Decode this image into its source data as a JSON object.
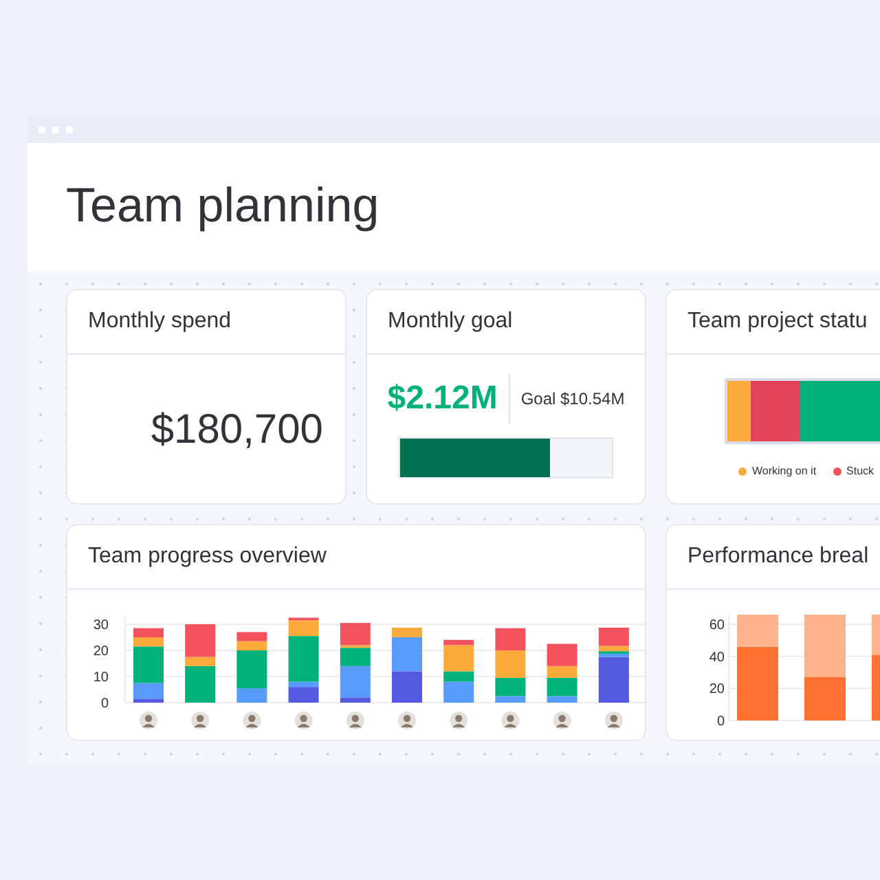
{
  "page": {
    "title": "Team planning"
  },
  "monthly_spend": {
    "title": "Monthly spend",
    "value": "$180,700"
  },
  "monthly_goal": {
    "title": "Monthly goal",
    "value": "$2.12M",
    "goal": "Goal $10.54M",
    "level": 0.71
  },
  "project_status": {
    "title": "Team project statu",
    "segments": [
      {
        "color": "#fdab3d",
        "level": 0.1
      },
      {
        "color": "#e2445c",
        "level": 0.22
      },
      {
        "color": "#00b27a",
        "level": 0.68
      }
    ],
    "legend": [
      {
        "label": "Working on it",
        "color": "#fdab3d"
      },
      {
        "label": "Stuck",
        "color": "#f2515e"
      }
    ]
  },
  "progress_overview": {
    "title": "Team progress overview",
    "chart_data": {
      "type": "bar",
      "stacked": true,
      "grid": true,
      "yticks": [
        0,
        10,
        20,
        30
      ],
      "ylim": [
        0,
        33
      ],
      "series": [
        {
          "color": "#5559df",
          "values": [
            1.5,
            0,
            0,
            6,
            2,
            12,
            0,
            0,
            0,
            17.5
          ]
        },
        {
          "color": "#579bfc",
          "values": [
            6,
            0,
            5.5,
            2,
            12,
            13,
            8,
            2.5,
            2.5,
            1.2
          ]
        },
        {
          "color": "#00b27a",
          "values": [
            14,
            14,
            14.5,
            17.5,
            7,
            0,
            4,
            7,
            7,
            1
          ]
        },
        {
          "color": "#fdab3d",
          "values": [
            3.5,
            3.5,
            3.5,
            6,
            1,
            3.7,
            10,
            10.5,
            4.5,
            2
          ]
        },
        {
          "color": "#f2515e",
          "values": [
            3.5,
            12.5,
            3.5,
            1,
            8.5,
            0,
            2,
            8.5,
            8.5,
            7
          ]
        }
      ]
    }
  },
  "performance": {
    "title": "Performance breal",
    "chart_data": {
      "type": "bar",
      "stacked": true,
      "grid": true,
      "yticks": [
        0,
        20,
        40,
        60
      ],
      "ylim": [
        0,
        66
      ],
      "series": [
        {
          "color": "#ff7233",
          "values": [
            46,
            27,
            41
          ]
        },
        {
          "color": "#ffb38e",
          "values": [
            20,
            39,
            25
          ]
        }
      ]
    }
  }
}
